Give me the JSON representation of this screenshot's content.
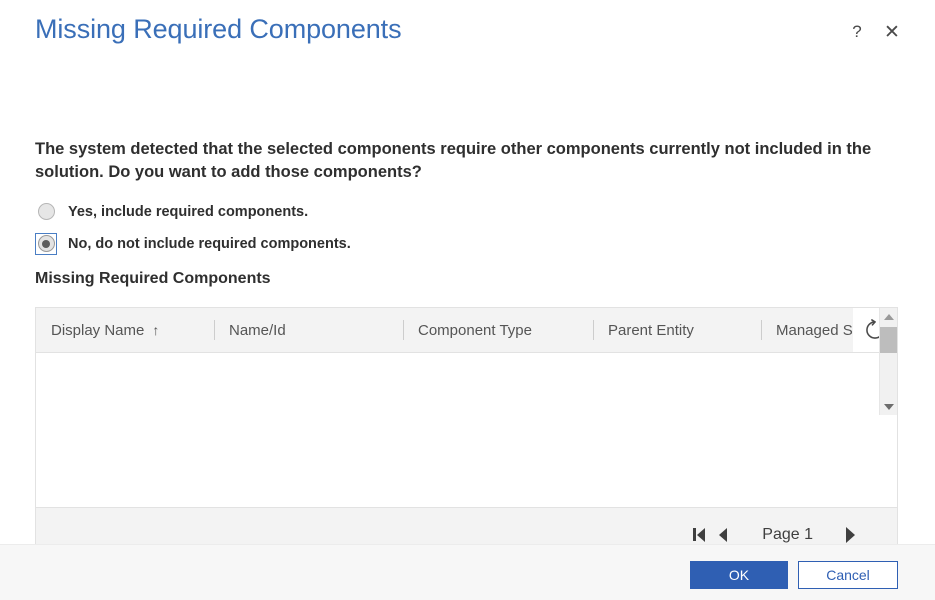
{
  "dialog": {
    "title": "Missing Required Components",
    "help_icon": "question-mark-icon",
    "close_icon": "close-icon",
    "help_glyph": "?",
    "close_glyph": "✕"
  },
  "prompt": {
    "text": "The system detected that the selected components require other components currently not included in the solution. Do you want to add those components?"
  },
  "radios": [
    {
      "label": "Yes, include required components.",
      "checked": false
    },
    {
      "label": "No, do not include required components.",
      "checked": true
    }
  ],
  "section": {
    "heading": "Missing Required Components"
  },
  "grid": {
    "columns": [
      {
        "label": "Display Name",
        "sorted": true,
        "sort_glyph": "↑"
      },
      {
        "label": "Name/Id",
        "sorted": false,
        "sort_glyph": ""
      },
      {
        "label": "Component Type",
        "sorted": false,
        "sort_glyph": ""
      },
      {
        "label": "Parent Entity",
        "sorted": false,
        "sort_glyph": ""
      },
      {
        "label": "Managed S",
        "sorted": false,
        "sort_glyph": ""
      }
    ],
    "rows": [],
    "refresh_icon": "refresh-spinner-icon",
    "pager": {
      "first_label": "First page",
      "previous_label": "Previous page",
      "page_label": "Page 1",
      "next_label": "Next page"
    },
    "vertical_scrollbar": {
      "up_icon": "scroll-up-arrow-icon",
      "down_icon": "scroll-down-arrow-icon"
    },
    "horizontal_scrollbar": {
      "left_icon": "scroll-left-arrow-icon",
      "right_icon": "scroll-right-arrow-icon"
    }
  },
  "footer": {
    "ok_label": "OK",
    "cancel_label": "Cancel"
  },
  "colors": {
    "title_blue": "#3a6fb8",
    "accent_blue": "#2f5fb3",
    "text": "#2f2f2f",
    "header_bg": "#f3f3f3",
    "footer_bg": "#f7f7f7",
    "scroll_thumb": "#bdbdbd"
  }
}
